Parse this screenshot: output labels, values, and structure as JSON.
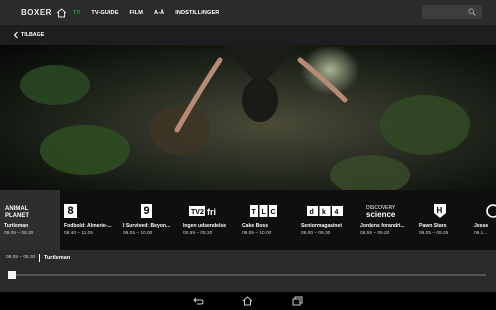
{
  "topbar": {
    "brand": "BOXER",
    "nav": [
      {
        "label": "TV",
        "active": true
      },
      {
        "label": "TV-GUIDE"
      },
      {
        "label": "FILM"
      },
      {
        "label": "A-Å"
      },
      {
        "label": "INDSTILLINGER"
      }
    ],
    "search_icon": "search-icon"
  },
  "backbar": {
    "label": "TILBAGE"
  },
  "channels": [
    {
      "logo": "Animal Planet",
      "title": "Turtleman",
      "time": "09.05 – 09.30",
      "active": true
    },
    {
      "logo": "8",
      "title": "Fodbold: Almerie-...",
      "time": "08.40 – 11.05"
    },
    {
      "logo": "9",
      "title": "I Survived: Beyon...",
      "time": "09.05 – 10.00"
    },
    {
      "logo": "TV2 fri",
      "title": "Ingen udsendelse",
      "time": "00.59 – 09.20"
    },
    {
      "logo": "TLC",
      "title": "Cake Boss",
      "time": "09.05 – 10.00"
    },
    {
      "logo": "dk4",
      "title": "Seniormagasinet",
      "time": "09.00 – 09.30"
    },
    {
      "logo": "discovery science",
      "title": "Jordens forandri...",
      "time": "08.55 – 09.20"
    },
    {
      "logo": "H",
      "title": "Pawn Stars",
      "time": "09.05 – 09.25"
    },
    {
      "logo": "J",
      "title": "Jesse",
      "time": "09.1..."
    }
  ],
  "now_playing": {
    "time": "09.05 – 09.30",
    "title": "Turtleman",
    "progress": 0
  },
  "colors": {
    "accent": "#1faa3a",
    "topbar": "#2b2b2d"
  }
}
